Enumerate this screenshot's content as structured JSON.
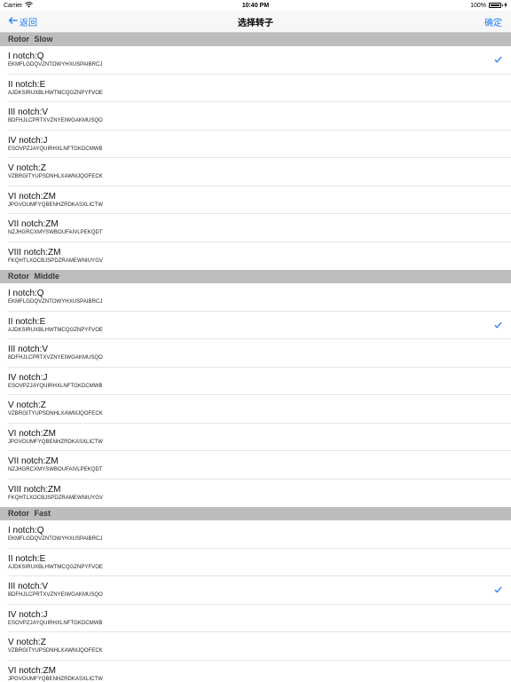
{
  "status_bar": {
    "carrier": "Carrier",
    "time": "10:40 PM",
    "battery": "100%"
  },
  "nav": {
    "back_label": "返回",
    "title": "选择转子",
    "confirm_label": "确定"
  },
  "accent_color": "#1f7cf2",
  "sections": [
    {
      "header": "Rotor Slow",
      "selected_index": 0,
      "rows": [
        {
          "title": "I notch:Q",
          "wiring": "EKMFLGDQVZNTOWYHXUSPAIBRCJ"
        },
        {
          "title": "II notch:E",
          "wiring": "AJDKSIRUXBLHWTMCQGZNPYFVOE"
        },
        {
          "title": "III notch:V",
          "wiring": "BDFHJLCPRTXVZNYEIWGAKMUSQO"
        },
        {
          "title": "IV notch:J",
          "wiring": "ESOVPZJAYQUIRHXLNFTGKDCMWB"
        },
        {
          "title": "V notch:Z",
          "wiring": "VZBRGITYUPSDNHLXAWMJQOFECK"
        },
        {
          "title": "VI notch:ZM",
          "wiring": "JPGVOUMFYQBENHZRDKASXLICTW"
        },
        {
          "title": "VII notch:ZM",
          "wiring": "NZJHGRCXMYSWBOUFAIVLPEKQDT"
        },
        {
          "title": "VIII notch:ZM",
          "wiring": "FKQHTLXOCBJSPDZRAMEWNIUYGV"
        }
      ]
    },
    {
      "header": "Rotor Middle",
      "selected_index": 1,
      "rows": [
        {
          "title": "I notch:Q",
          "wiring": "EKMFLGDQVZNTOWYHXUSPAIBRCJ"
        },
        {
          "title": "II notch:E",
          "wiring": "AJDKSIRUXBLHWTMCQGZNPYFVOE"
        },
        {
          "title": "III notch:V",
          "wiring": "BDFHJLCPRTXVZNYEIWGAKMUSQO"
        },
        {
          "title": "IV notch:J",
          "wiring": "ESOVPZJAYQUIRHXLNFTGKDCMWB"
        },
        {
          "title": "V notch:Z",
          "wiring": "VZBRGITYUPSDNHLXAWMJQOFECK"
        },
        {
          "title": "VI notch:ZM",
          "wiring": "JPGVOUMFYQBENHZRDKASXLICTW"
        },
        {
          "title": "VII notch:ZM",
          "wiring": "NZJHGRCXMYSWBOUFAIVLPEKQDT"
        },
        {
          "title": "VIII notch:ZM",
          "wiring": "FKQHTLXOCBJSPDZRAMEWNIUYGV"
        }
      ]
    },
    {
      "header": "Rotor Fast",
      "selected_index": 2,
      "rows": [
        {
          "title": "I notch:Q",
          "wiring": "EKMFLGDQVZNTOWYHXUSPAIBRCJ"
        },
        {
          "title": "II notch:E",
          "wiring": "AJDKSIRUXBLHWTMCQGZNPYFVOE"
        },
        {
          "title": "III notch:V",
          "wiring": "BDFHJLCPRTXVZNYEIWGAKMUSQO"
        },
        {
          "title": "IV notch:J",
          "wiring": "ESOVPZJAYQUIRHXLNFTGKDCMWB"
        },
        {
          "title": "V notch:Z",
          "wiring": "VZBRGITYUPSDNHLXAWMJQOFECK"
        },
        {
          "title": "VI notch:ZM",
          "wiring": "JPGVOUMFYQBENHZRDKASXLICTW"
        }
      ]
    }
  ]
}
